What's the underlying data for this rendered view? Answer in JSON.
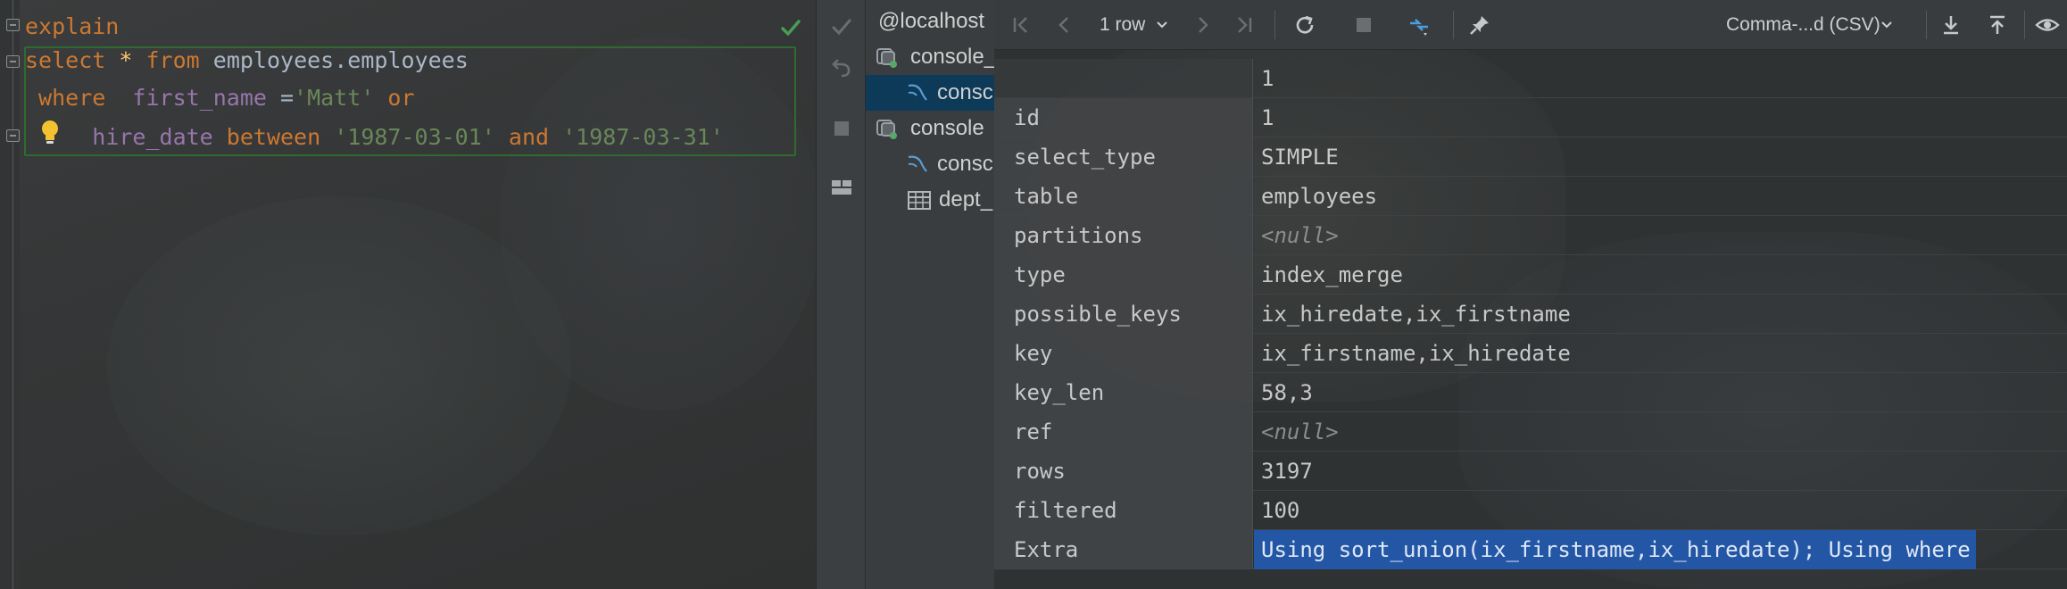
{
  "editor": {
    "lines": [
      [
        {
          "t": "explain",
          "c": "kw"
        }
      ],
      [
        {
          "t": "select",
          "c": "kw"
        },
        {
          "t": " ",
          "c": "id"
        },
        {
          "t": "*",
          "c": "star"
        },
        {
          "t": " ",
          "c": "id"
        },
        {
          "t": "from",
          "c": "kw"
        },
        {
          "t": " employees.employees",
          "c": "id"
        }
      ],
      [
        {
          "t": " where",
          "c": "kw"
        },
        {
          "t": "  ",
          "c": "id"
        },
        {
          "t": "first_name",
          "c": "col"
        },
        {
          "t": " =",
          "c": "op"
        },
        {
          "t": "'Matt'",
          "c": "str"
        },
        {
          "t": " ",
          "c": "id"
        },
        {
          "t": "or",
          "c": "kw"
        }
      ],
      [
        {
          "t": "     ",
          "c": "id"
        },
        {
          "t": "hire_date",
          "c": "col"
        },
        {
          "t": " ",
          "c": "id"
        },
        {
          "t": "between",
          "c": "kw"
        },
        {
          "t": " ",
          "c": "id"
        },
        {
          "t": "'1987-03-01'",
          "c": "str"
        },
        {
          "t": " ",
          "c": "id"
        },
        {
          "t": "and",
          "c": "kw"
        },
        {
          "t": " ",
          "c": "id"
        },
        {
          "t": "'1987-03-31'",
          "c": "str"
        }
      ]
    ]
  },
  "tree": {
    "items": [
      {
        "label": "@localhost",
        "icon": "none",
        "level": 0
      },
      {
        "label": "console_",
        "icon": "console-group-icon",
        "level": 0
      },
      {
        "label": "consc",
        "icon": "mysql-console-icon",
        "level": 1,
        "selected": true
      },
      {
        "label": "console",
        "icon": "console-group-icon",
        "level": 0
      },
      {
        "label": "consc",
        "icon": "mysql-console-icon",
        "level": 1
      },
      {
        "label": "dept_",
        "icon": "table-icon",
        "level": 1
      }
    ]
  },
  "toolbar": {
    "rows_count": "1 row",
    "format": "Comma-...d (CSV)"
  },
  "grid": {
    "header_value": "1",
    "rows": [
      {
        "name": "id",
        "value": "1"
      },
      {
        "name": "select_type",
        "value": "SIMPLE"
      },
      {
        "name": "table",
        "value": "employees"
      },
      {
        "name": "partitions",
        "value": "<null>",
        "null": true
      },
      {
        "name": "type",
        "value": "index_merge"
      },
      {
        "name": "possible_keys",
        "value": "ix_hiredate,ix_firstname"
      },
      {
        "name": "key",
        "value": "ix_firstname,ix_hiredate"
      },
      {
        "name": "key_len",
        "value": "58,3"
      },
      {
        "name": "ref",
        "value": "<null>",
        "null": true
      },
      {
        "name": "rows",
        "value": "3197"
      },
      {
        "name": "filtered",
        "value": "100"
      },
      {
        "name": "Extra",
        "value": "Using sort_union(ix_firstname,ix_hiredate); Using where",
        "selected": true
      }
    ]
  },
  "colors": {
    "keyword": "#cc7832",
    "column": "#9876aa",
    "string": "#6a8759",
    "selection": "#2357a6",
    "check": "#499c54"
  }
}
